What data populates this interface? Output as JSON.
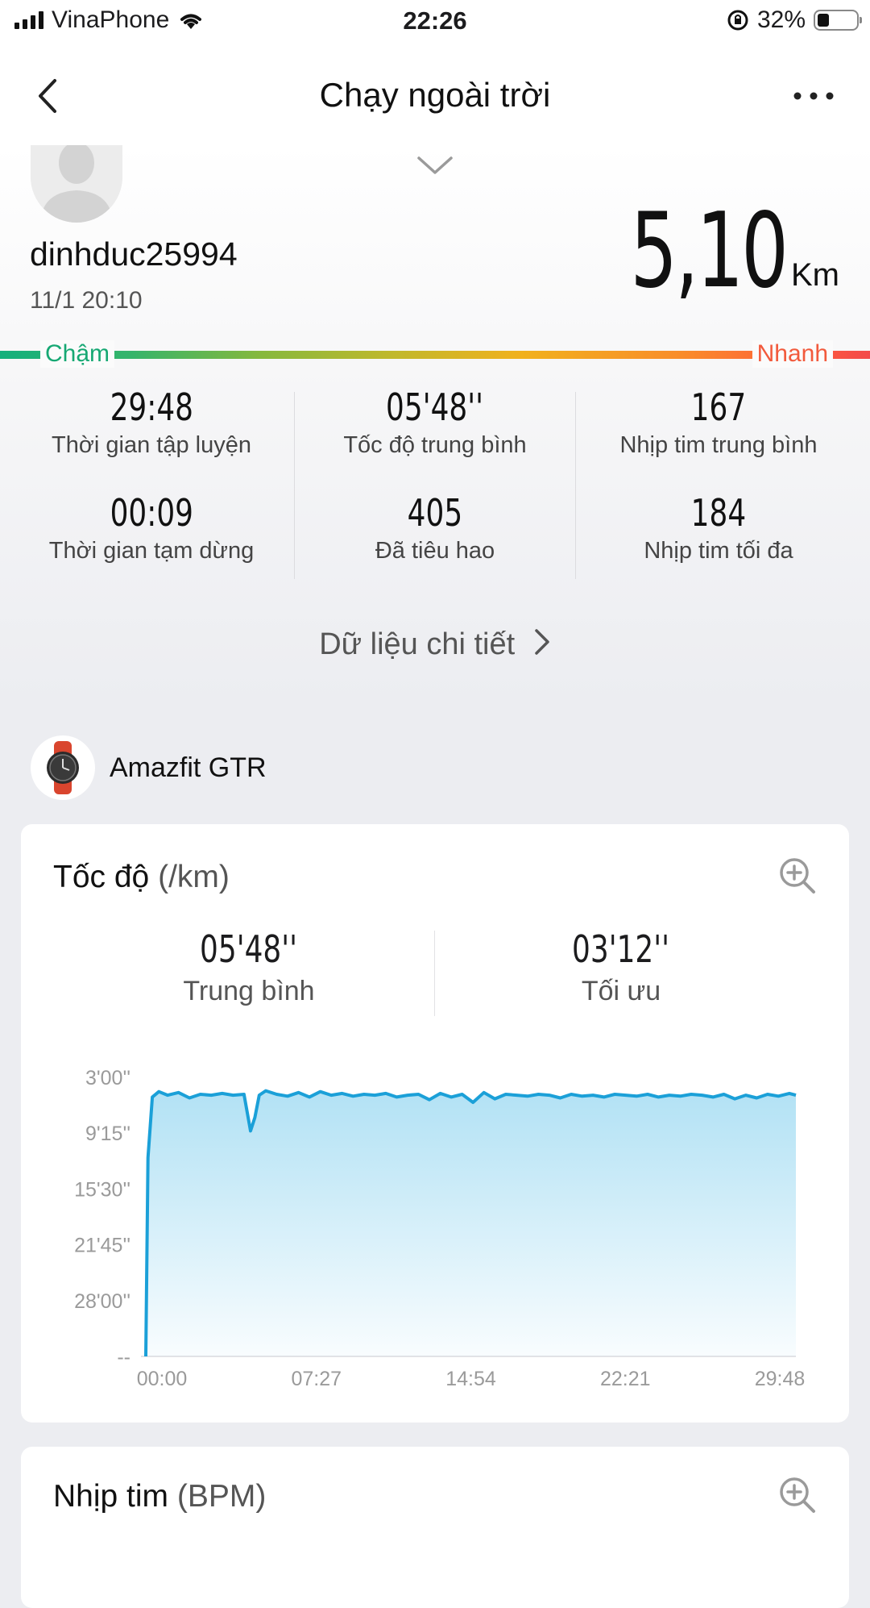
{
  "status_bar": {
    "carrier": "VinaPhone",
    "time": "22:26",
    "battery": "32%"
  },
  "nav": {
    "title": "Chạy ngoài trời"
  },
  "profile": {
    "username": "dinhduc25994",
    "date": "11/1 20:10"
  },
  "distance": {
    "value": "5,10",
    "unit": "Km"
  },
  "speed_scale": {
    "slow": "Chậm",
    "fast": "Nhanh"
  },
  "stats": [
    {
      "value": "29:48",
      "label": "Thời gian tập luyện"
    },
    {
      "value": "05'48''",
      "label": "Tốc độ trung bình"
    },
    {
      "value": "167",
      "label": "Nhịp tim trung bình"
    },
    {
      "value": "00:09",
      "label": "Thời gian tạm dừng"
    },
    {
      "value": "405",
      "label": "Đã tiêu hao"
    },
    {
      "value": "184",
      "label": "Nhịp tim tối đa"
    }
  ],
  "detail_link": "Dữ liệu chi tiết",
  "device": {
    "name": "Amazfit GTR"
  },
  "speed_card": {
    "title": "Tốc độ",
    "unit": "(/km)",
    "avg_value": "05'48''",
    "avg_label": "Trung bình",
    "best_value": "03'12''",
    "best_label": "Tối ưu"
  },
  "hr_card": {
    "title": "Nhịp tim",
    "unit": "(BPM)"
  },
  "colors": {
    "line": "#1ba0d8",
    "fill_top": "#aee0f4",
    "slow": "#16a873",
    "fast": "#f25a3c"
  },
  "chart_data": {
    "type": "area",
    "title": "",
    "xlabel": "",
    "ylabel": "",
    "x_tick_labels": [
      "00:00",
      "07:27",
      "14:54",
      "22:21",
      "29:48"
    ],
    "y_tick_labels": [
      "3'00''",
      "9'15''",
      "15'30''",
      "21'45''",
      "28'00''",
      "--"
    ],
    "x_range_minutes": [
      0,
      29.8
    ],
    "y_range_pace_minutes": [
      3.0,
      34.25
    ],
    "y_inverted": true,
    "series": [
      {
        "x_minutes": [
          0.0,
          0.1,
          0.3,
          0.6,
          1.0,
          1.5,
          2.0,
          2.5,
          3.0,
          3.5,
          4.0,
          4.5,
          4.8,
          5.0,
          5.2,
          5.5,
          6.0,
          6.5,
          7.0,
          7.5,
          8.0,
          8.5,
          9.0,
          9.5,
          10.0,
          10.5,
          11.0,
          11.5,
          12.0,
          12.5,
          13.0,
          13.5,
          14.0,
          14.5,
          15.0,
          15.5,
          16.0,
          16.5,
          17.0,
          17.5,
          18.0,
          18.5,
          19.0,
          19.5,
          20.0,
          20.5,
          21.0,
          21.5,
          22.0,
          22.5,
          23.0,
          23.5,
          24.0,
          24.5,
          25.0,
          25.5,
          26.0,
          26.5,
          27.0,
          27.5,
          28.0,
          28.5,
          29.0,
          29.5,
          29.8
        ],
        "pace_minutes": [
          34.25,
          12.0,
          5.2,
          4.6,
          5.0,
          4.7,
          5.3,
          4.9,
          5.0,
          4.8,
          5.0,
          4.9,
          9.0,
          7.5,
          5.0,
          4.5,
          4.9,
          5.1,
          4.7,
          5.2,
          4.6,
          5.0,
          4.8,
          5.1,
          4.9,
          5.0,
          4.8,
          5.2,
          5.0,
          4.9,
          5.5,
          4.8,
          5.2,
          4.9,
          5.8,
          4.7,
          5.4,
          4.9,
          5.0,
          5.1,
          4.9,
          5.0,
          5.3,
          4.9,
          5.1,
          5.0,
          5.2,
          4.9,
          5.0,
          5.1,
          4.9,
          5.2,
          5.0,
          5.1,
          4.9,
          5.0,
          5.2,
          4.9,
          5.4,
          5.0,
          5.3,
          4.9,
          5.1,
          4.8,
          5.0
        ]
      }
    ],
    "grid": false
  }
}
